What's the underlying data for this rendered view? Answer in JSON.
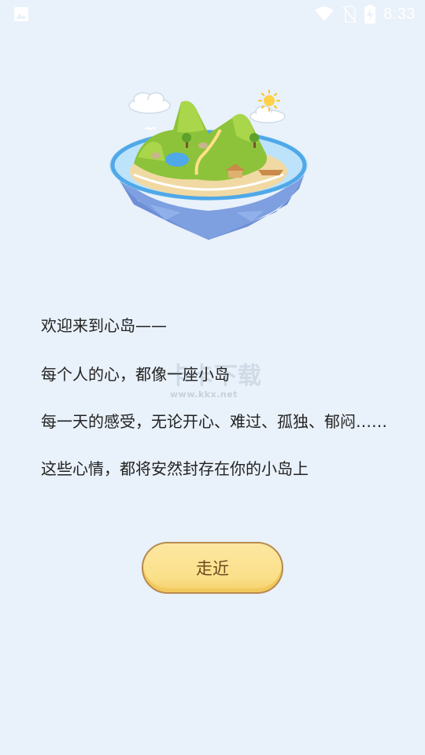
{
  "status_bar": {
    "time": "8:33",
    "icons": [
      "image-icon",
      "wifi-icon",
      "no-sim-icon",
      "battery-charging-icon"
    ]
  },
  "illustration": {
    "icon": "floating-island-illustration"
  },
  "intro": {
    "lines": [
      "欢迎来到心岛——",
      "每个人的心，都像一座小岛",
      "每一天的感受，无论开心、难过、孤独、郁闷……",
      "这些心情，都将安然封存在你的小岛上"
    ]
  },
  "watermark": {
    "logo": "卡卡下载",
    "url": "www.kkx.net"
  },
  "actions": {
    "approach_label": "走近"
  },
  "colors": {
    "background": "#e9f1fa",
    "button_fill": "#fbe08a",
    "button_border": "#b98a4e",
    "button_text": "#6c4a1e"
  }
}
